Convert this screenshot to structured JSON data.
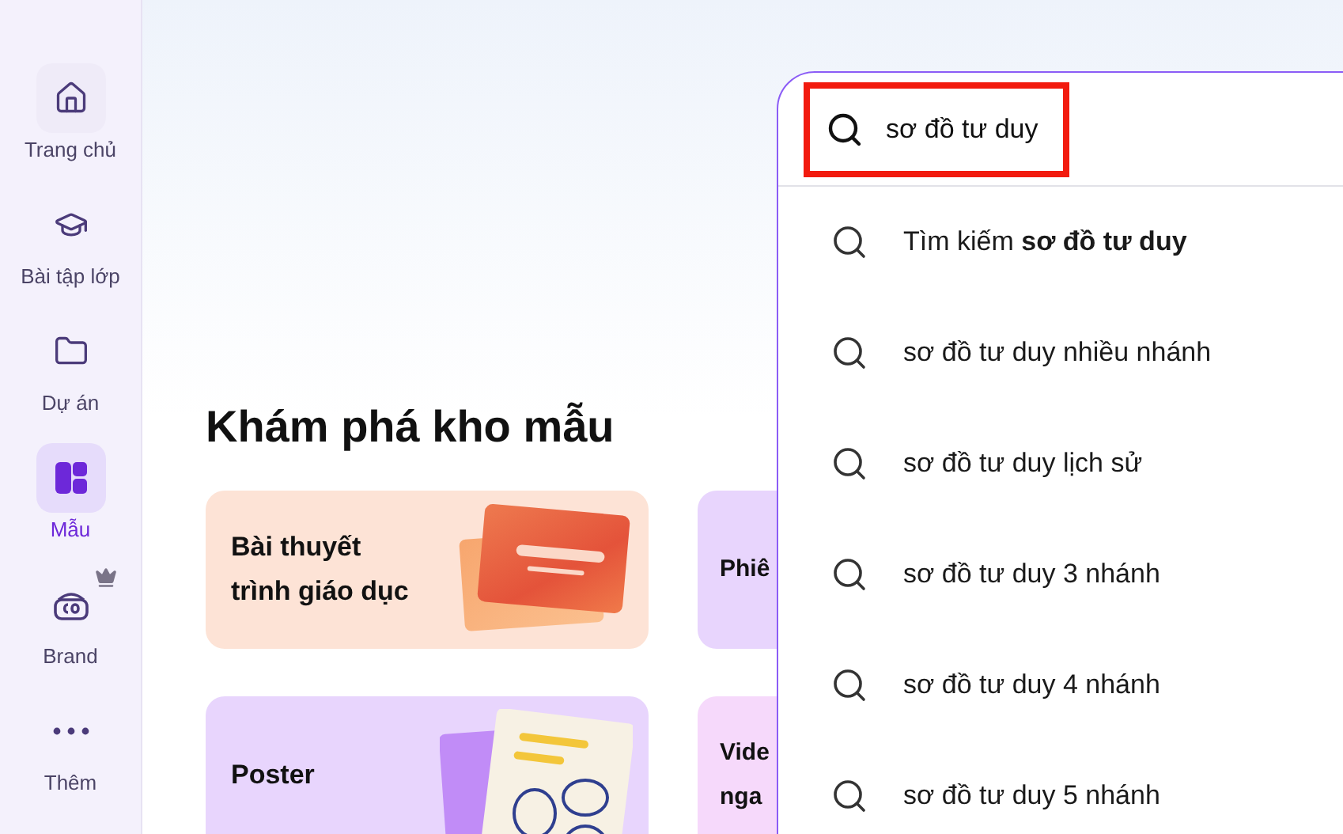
{
  "sidebar": {
    "items": [
      {
        "kind": "home",
        "label": "Trang chủ",
        "selected": false,
        "premium": false
      },
      {
        "kind": "class",
        "label": "Bài tập lớp",
        "selected": false,
        "premium": false
      },
      {
        "kind": "folder",
        "label": "Dự án",
        "selected": false,
        "premium": false
      },
      {
        "kind": "templates",
        "label": "Mẫu",
        "selected": true,
        "premium": false
      },
      {
        "kind": "brand",
        "label": "Brand",
        "selected": false,
        "premium": true
      },
      {
        "kind": "more",
        "label": "Thêm",
        "selected": false,
        "premium": false
      }
    ]
  },
  "section": {
    "title": "Khám phá kho mẫu",
    "cards": [
      {
        "kind": "slides",
        "lines": [
          "Bài thuyết",
          "trình giáo dục"
        ],
        "color": "#fde3d6"
      },
      {
        "kind": "plain",
        "lines": [
          "Phiê"
        ],
        "color": "#e8d5fd"
      },
      {
        "kind": "poster",
        "lines": [
          "Poster"
        ],
        "color": "#e8d5fd"
      },
      {
        "kind": "plain",
        "lines": [
          "Vide",
          "nga"
        ],
        "color": "#f6d9fb"
      }
    ]
  },
  "search": {
    "value": "sơ đồ tư duy",
    "highlighted": true,
    "suggestions": [
      "Tìm kiếm **sơ đồ tư duy**",
      "sơ đồ tư duy nhiều nhánh",
      "sơ đồ tư duy lịch sử",
      "sơ đồ tư duy 3 nhánh",
      "sơ đồ tư duy 4 nhánh",
      "sơ đồ tư duy 5 nhánh"
    ]
  }
}
